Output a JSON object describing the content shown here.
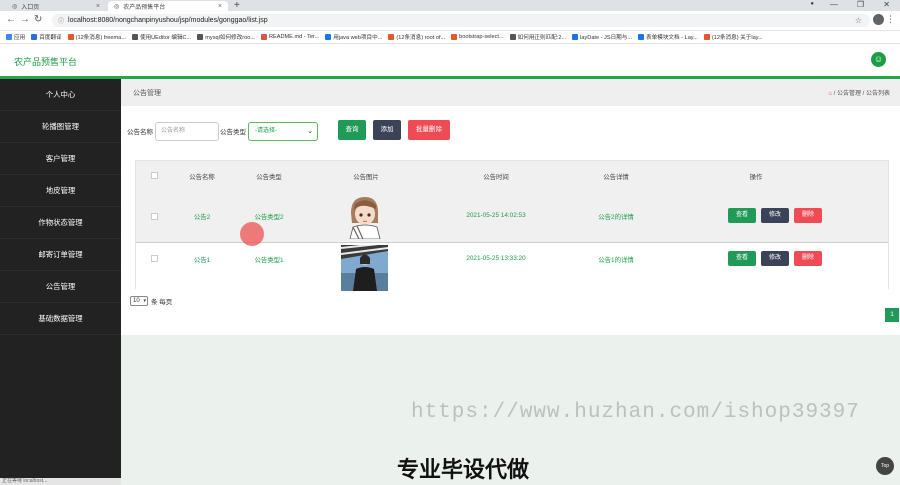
{
  "browser": {
    "tabs": [
      {
        "label": "入口页"
      },
      {
        "label": "农产品预售平台"
      }
    ],
    "new_tab": "+",
    "url": "localhost:8080/nongchanpinyushou/jsp/modules/gonggao/list.jsp",
    "bookmarks": [
      {
        "label": "应用",
        "color": "#4285f4"
      },
      {
        "label": "百度翻译",
        "color": "#2a6fd6"
      },
      {
        "label": "(12条消息) freema...",
        "color": "#e4572e"
      },
      {
        "label": "使用UEditor 编辑C...",
        "color": "#555555"
      },
      {
        "label": "mysql如何修改roo...",
        "color": "#555555"
      },
      {
        "label": "README.md - Ter...",
        "color": "#d9534f"
      },
      {
        "label": "用java web项目中...",
        "color": "#1a73e8"
      },
      {
        "label": "(12条消息) root of...",
        "color": "#e4572e"
      },
      {
        "label": "bootstrap-select...",
        "color": "#e4572e"
      },
      {
        "label": "如何用正则匹配:2...",
        "color": "#555555"
      },
      {
        "label": "layDate - JS日期与...",
        "color": "#1a73e8"
      },
      {
        "label": "表单模块文档 - Lay...",
        "color": "#1a73e8"
      },
      {
        "label": "(12条消息) 关于lay...",
        "color": "#e4572e"
      }
    ]
  },
  "app": {
    "title": "农产品预售平台",
    "accent": "#1a9d45",
    "sidebar": {
      "items": [
        {
          "label": "个人中心"
        },
        {
          "label": "轮播图管理"
        },
        {
          "label": "客户管理"
        },
        {
          "label": "地皮管理"
        },
        {
          "label": "作物状态管理"
        },
        {
          "label": "邮寄订单管理"
        },
        {
          "label": "公告管理"
        },
        {
          "label": "基础数据管理"
        }
      ],
      "status": "正在等待 localhost..."
    },
    "page": {
      "title": "公告管理",
      "breadcrumb": [
        "公告管理",
        "公告列表"
      ],
      "breadcrumb_sep": "/",
      "search": {
        "name_label": "公告名称",
        "name_placeholder": "公告名称",
        "type_label": "公告类型",
        "type_selected": "-请选择-",
        "query_button": "查询",
        "add_button": "添加",
        "batch_delete_button": "批量删除"
      },
      "table": {
        "headers": [
          "公告名称",
          "公告类型",
          "公告图片",
          "公告时间",
          "公告详情",
          "操作"
        ],
        "rows": [
          {
            "name": "公告2",
            "type": "公告类型2",
            "image": "cartoon-girl",
            "time": "2021-05-25 14:02:53",
            "detail": "公告2的详情"
          },
          {
            "name": "公告1",
            "type": "公告类型1",
            "image": "person-photo",
            "time": "2021-05-25 13:33:20",
            "detail": "公告1的详情"
          }
        ],
        "actions": {
          "view": "查看",
          "edit": "修改",
          "delete": "删除"
        }
      },
      "pager": {
        "page_size": "10",
        "page_size_label": "条 每页",
        "current_page": "1"
      }
    }
  },
  "overlay": {
    "watermark": "https://www.huzhan.com/ishop39397",
    "slogan": "专业毕设代做",
    "top_button": "Top"
  }
}
